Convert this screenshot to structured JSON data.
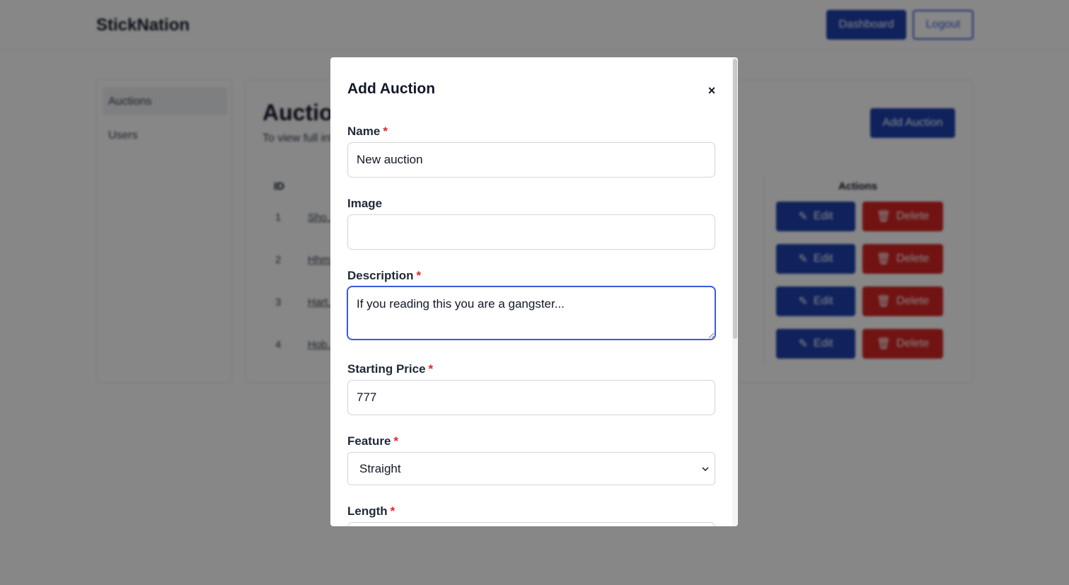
{
  "navbar": {
    "brand": "StickNation",
    "dashboard_label": "Dashboard",
    "logout_label": "Logout"
  },
  "sidebar": {
    "items": [
      {
        "label": "Auctions",
        "active": true
      },
      {
        "label": "Users",
        "active": false
      }
    ]
  },
  "main": {
    "title": "Auctions",
    "subtitle": "To view full info",
    "add_button_label": "Add Auction",
    "table": {
      "headers": {
        "id": "ID",
        "actions": "Actions"
      },
      "rows": [
        {
          "id": "1",
          "name": "Sho..."
        },
        {
          "id": "2",
          "name": "Hhm..."
        },
        {
          "id": "3",
          "name": "Hart..."
        },
        {
          "id": "4",
          "name": "Hob..."
        }
      ],
      "edit_label": "Edit",
      "delete_label": "Delete"
    }
  },
  "modal": {
    "title": "Add Auction",
    "close_label": "×",
    "required_mark": "*",
    "fields": {
      "name": {
        "label": "Name",
        "value": "New auction"
      },
      "image": {
        "label": "Image",
        "value": ""
      },
      "description": {
        "label": "Description",
        "value": "If you reading this you are a gangster..."
      },
      "starting_price": {
        "label": "Starting Price",
        "value": "777"
      },
      "feature": {
        "label": "Feature",
        "value": "Straight"
      },
      "length": {
        "label": "Length"
      }
    }
  },
  "colors": {
    "primary": "#1e40af",
    "danger": "#d62525",
    "required": "#dc2626",
    "focus": "#3b5bdb"
  }
}
